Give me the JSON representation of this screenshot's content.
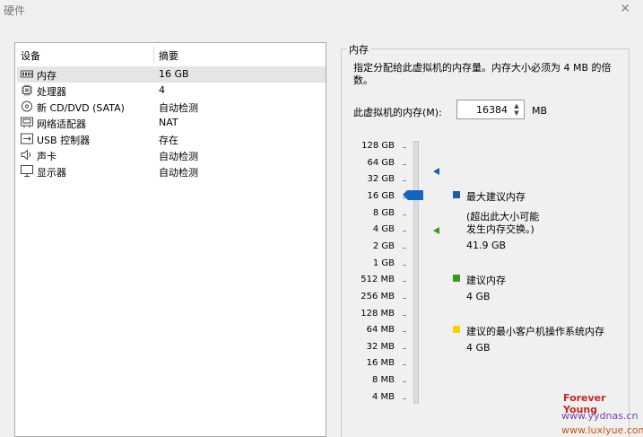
{
  "window": {
    "title": "硬件",
    "close_glyph": "✕"
  },
  "devices": {
    "header": {
      "device": "设备",
      "summary": "摘要"
    },
    "items": [
      {
        "name": "内存",
        "summary": "16 GB",
        "icon": "memory-icon",
        "selected": true
      },
      {
        "name": "处理器",
        "summary": "4",
        "icon": "processor-icon"
      },
      {
        "name": "新 CD/DVD (SATA)",
        "summary": "自动检测",
        "icon": "cd-dvd-icon"
      },
      {
        "name": "网络适配器",
        "summary": "NAT",
        "icon": "network-adapter-icon"
      },
      {
        "name": "USB 控制器",
        "summary": "存在",
        "icon": "usb-controller-icon"
      },
      {
        "name": "声卡",
        "summary": "自动检测",
        "icon": "sound-card-icon"
      },
      {
        "name": "显示器",
        "summary": "自动检测",
        "icon": "display-icon"
      }
    ]
  },
  "memory": {
    "group_title": "内存",
    "description": "指定分配给此虚拟机的内存量。内存大小必须为 4 MB 的倍数。",
    "label": "此虚拟机的内存(M):",
    "value": "16384",
    "unit": "MB",
    "scale_labels": [
      "128 GB",
      "64 GB",
      "32 GB",
      "16 GB",
      "8 GB",
      "4 GB",
      "2 GB",
      "1 GB",
      "512 MB",
      "256 MB",
      "128 MB",
      "64 MB",
      "32 MB",
      "16 MB",
      "8 MB",
      "4 MB"
    ],
    "slider_value": "16 GB",
    "legend": {
      "max": {
        "label": "最大建议内存",
        "note1": "(超出此大小可能",
        "note2": "发生内存交换。)",
        "value": "41.9 GB",
        "color": "#1a5fa8"
      },
      "recommended": {
        "label": "建议内存",
        "value": "4 GB",
        "color": "#3a9a1c"
      },
      "min_guest": {
        "label": "建议的最小客户机操作系统内存",
        "value": "4 GB",
        "color": "#f5d400"
      }
    }
  },
  "watermark": {
    "line1": "Forever Young",
    "line2": "www.yydnas.cn",
    "line3": "www.luxiyue.com"
  }
}
